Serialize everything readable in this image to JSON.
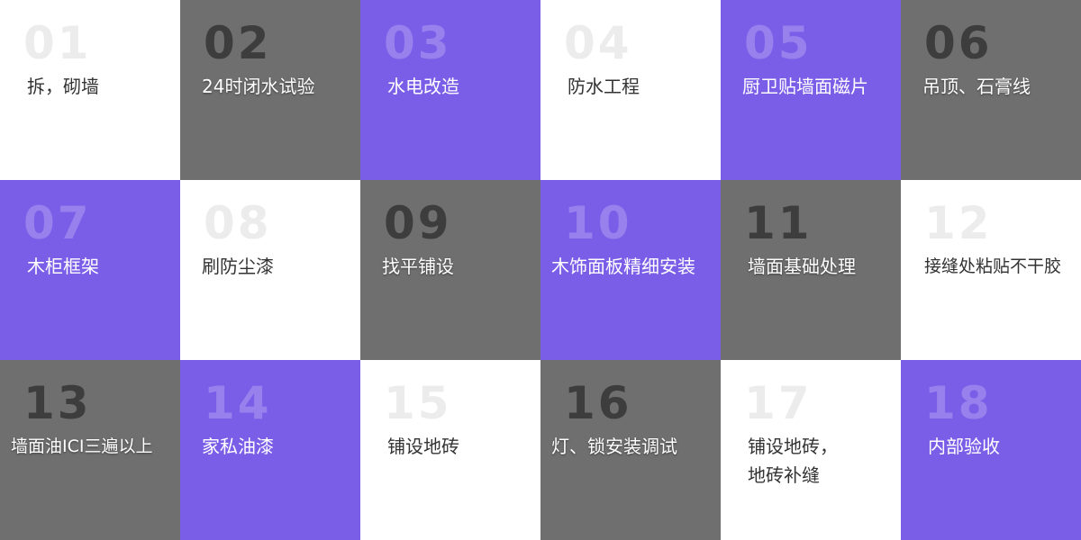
{
  "colors": {
    "purple": "#7b5ee8",
    "white": "#ffffff",
    "dark_text": "#333333"
  },
  "tiles": [
    {
      "num": "01",
      "label": "拆，砌墙",
      "style": "white"
    },
    {
      "num": "02",
      "label": "24时闭水试验",
      "style": "photo"
    },
    {
      "num": "03",
      "label": "水电改造",
      "style": "purple"
    },
    {
      "num": "04",
      "label": "防水工程",
      "style": "white"
    },
    {
      "num": "05",
      "label": "厨卫贴墙面磁片",
      "style": "purple"
    },
    {
      "num": "06",
      "label": "吊顶、石膏线",
      "style": "photo"
    },
    {
      "num": "07",
      "label": "木柜框架",
      "style": "purple"
    },
    {
      "num": "08",
      "label": "刷防尘漆",
      "style": "white"
    },
    {
      "num": "09",
      "label": "找平铺设",
      "style": "photo"
    },
    {
      "num": "10",
      "label": "木饰面板精细安装",
      "style": "purple"
    },
    {
      "num": "11",
      "label": "墙面基础处理",
      "style": "photo"
    },
    {
      "num": "12",
      "label": "接缝处粘贴不干胶",
      "style": "white"
    },
    {
      "num": "13",
      "label": "墙面油ICI三遍以上",
      "style": "photo"
    },
    {
      "num": "14",
      "label": "家私油漆",
      "style": "purple"
    },
    {
      "num": "15",
      "label": "铺设地砖",
      "style": "white"
    },
    {
      "num": "16",
      "label": "灯、锁安装调试",
      "style": "photo"
    },
    {
      "num": "17",
      "label": "铺设地砖，\n地砖补缝",
      "style": "white"
    },
    {
      "num": "18",
      "label": "内部验收",
      "style": "purple"
    }
  ]
}
